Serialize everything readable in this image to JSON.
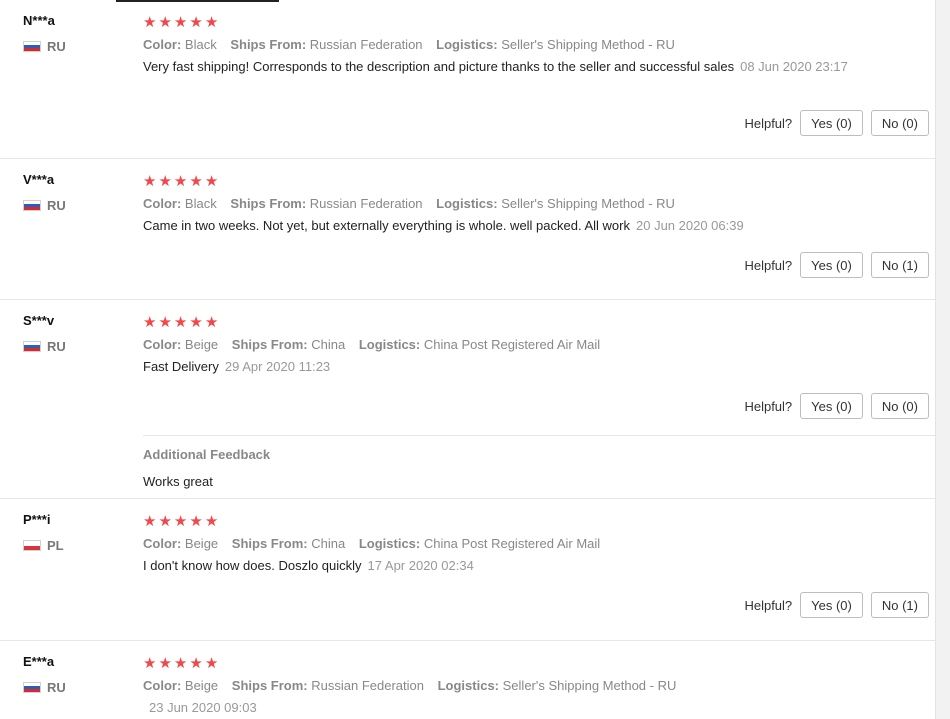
{
  "helpful_label": "Helpful?",
  "star_color": "#f0484b",
  "reviews": [
    {
      "user": "N***a",
      "country": "RU",
      "flag": "ru-flag-icon",
      "stars": 5,
      "color_key": "Color:",
      "color": "Black",
      "ships_key": "Ships From:",
      "ships_from": "Russian Federation",
      "logistics_key": "Logistics:",
      "logistics": "Seller's Shipping Method - RU",
      "comment": "Very fast shipping! Corresponds to the description and picture thanks to the seller and successful sales",
      "date": "08 Jun 2020 23:17",
      "yes": "Yes (0)",
      "no": "No (0)"
    },
    {
      "user": "V***a",
      "country": "RU",
      "flag": "ru-flag-icon",
      "stars": 5,
      "color_key": "Color:",
      "color": "Black",
      "ships_key": "Ships From:",
      "ships_from": "Russian Federation",
      "logistics_key": "Logistics:",
      "logistics": "Seller's Shipping Method - RU",
      "comment": "Came in two weeks. Not yet, but externally everything is whole. well packed. All work",
      "date": "20 Jun 2020 06:39",
      "yes": "Yes (0)",
      "no": "No (1)"
    },
    {
      "user": "S***v",
      "country": "RU",
      "flag": "ru-flag-icon",
      "stars": 5,
      "color_key": "Color:",
      "color": "Beige",
      "ships_key": "Ships From:",
      "ships_from": "China",
      "logistics_key": "Logistics:",
      "logistics": "China Post Registered Air Mail",
      "comment": "Fast Delivery",
      "date": "29 Apr 2020 11:23",
      "yes": "Yes (0)",
      "no": "No (0)",
      "additional_title": "Additional Feedback",
      "additional_text": "Works great"
    },
    {
      "user": "P***i",
      "country": "PL",
      "flag": "pl-flag-icon",
      "stars": 5,
      "color_key": "Color:",
      "color": "Beige",
      "ships_key": "Ships From:",
      "ships_from": "China",
      "logistics_key": "Logistics:",
      "logistics": "China Post Registered Air Mail",
      "comment": "I don't know how does. Doszlo quickly",
      "date": "17 Apr 2020 02:34",
      "yes": "Yes (0)",
      "no": "No (1)"
    },
    {
      "user": "E***a",
      "country": "RU",
      "flag": "ru-flag-icon",
      "stars": 5,
      "color_key": "Color:",
      "color": "Beige",
      "ships_key": "Ships From:",
      "ships_from": "Russian Federation",
      "logistics_key": "Logistics:",
      "logistics": "Seller's Shipping Method - RU",
      "comment": "",
      "date": "23 Jun 2020 09:03"
    }
  ]
}
